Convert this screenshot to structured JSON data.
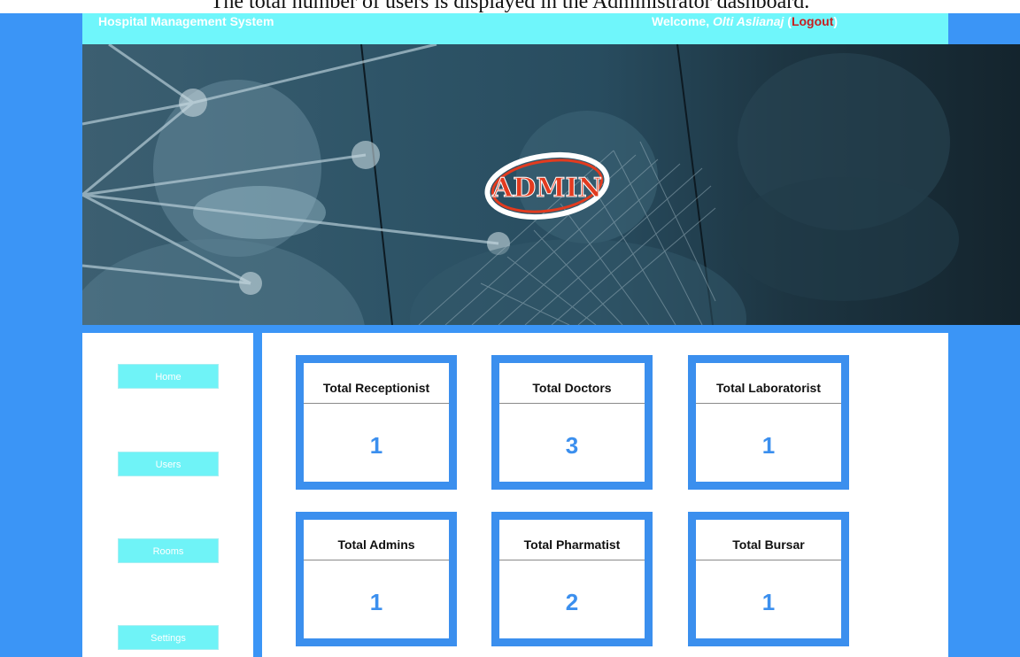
{
  "caption": "The total number of users is displayed in the Administrator dashboard.",
  "header": {
    "app_title": "Hospital Management System",
    "welcome_prefix": "Welcome, ",
    "user_name": "Olti Aslianaj",
    "paren_open": " (",
    "logout_label": "Logout",
    "paren_close": ")"
  },
  "banner": {
    "logo_text": "ADMIN"
  },
  "sidebar": {
    "items": [
      {
        "label": "Home"
      },
      {
        "label": "Users"
      },
      {
        "label": "Rooms"
      },
      {
        "label": "Settings"
      }
    ]
  },
  "stats": [
    {
      "title": "Total Receptionist",
      "count": "1"
    },
    {
      "title": "Total Doctors",
      "count": "3"
    },
    {
      "title": "Total Laboratorist",
      "count": "1"
    },
    {
      "title": "Total Admins",
      "count": "1"
    },
    {
      "title": "Total Pharmatist",
      "count": "2"
    },
    {
      "title": "Total Bursar",
      "count": "1"
    }
  ],
  "colors": {
    "page_bg": "#3b95f6",
    "header_bg": "#6ff6fb",
    "card_border": "#3b8fee",
    "count_text": "#3b8fee",
    "logout_text": "#c81e1e"
  }
}
